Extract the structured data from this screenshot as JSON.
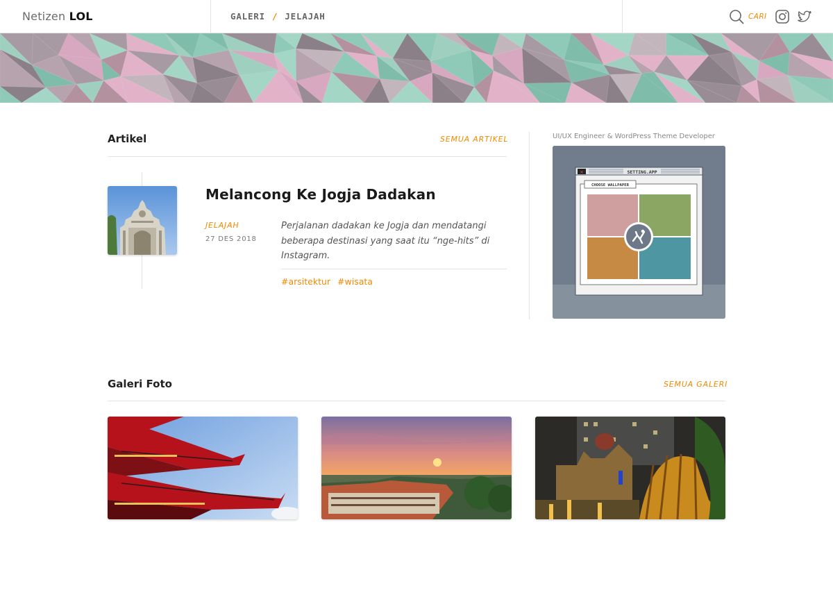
{
  "header": {
    "logo_light": "Netizen",
    "logo_bold": "LOL",
    "nav": [
      "GALERI",
      "JELAJAH"
    ],
    "nav_separator": "/",
    "search_label": "CARI",
    "icons": [
      "search-icon",
      "instagram-icon",
      "twitter-icon"
    ]
  },
  "articles": {
    "title": "Artikel",
    "all_link": "SEMUA ARTIKEL",
    "post": {
      "title": "Melancong Ke Jogja Dadakan",
      "category": "JELAJAH",
      "date": "27 DES 2018",
      "excerpt": "Perjalanan dadakan ke Jogja dan mendatangi beberapa destinasi yang saat itu “nge-hits” di Instagram.",
      "tags": [
        "#arsitektur",
        "#wisata"
      ]
    }
  },
  "sidebar": {
    "caption": "UI/UX Engineer & WordPress Theme Developer",
    "window_title": "SETTING.APP",
    "button_label": "CHOOSE WALLPAPER"
  },
  "gallery": {
    "title": "Galeri Foto",
    "all_link": "SEMUA GALERI"
  },
  "colors": {
    "accent": "#f08a00",
    "border": "#e3e3e3",
    "banner_pink": "#e2b3c8",
    "banner_green": "#8fcab8",
    "tile_pink": "#cf9e9e",
    "tile_green": "#8aa662",
    "tile_orange": "#c68a44",
    "tile_teal": "#4e96a2"
  }
}
